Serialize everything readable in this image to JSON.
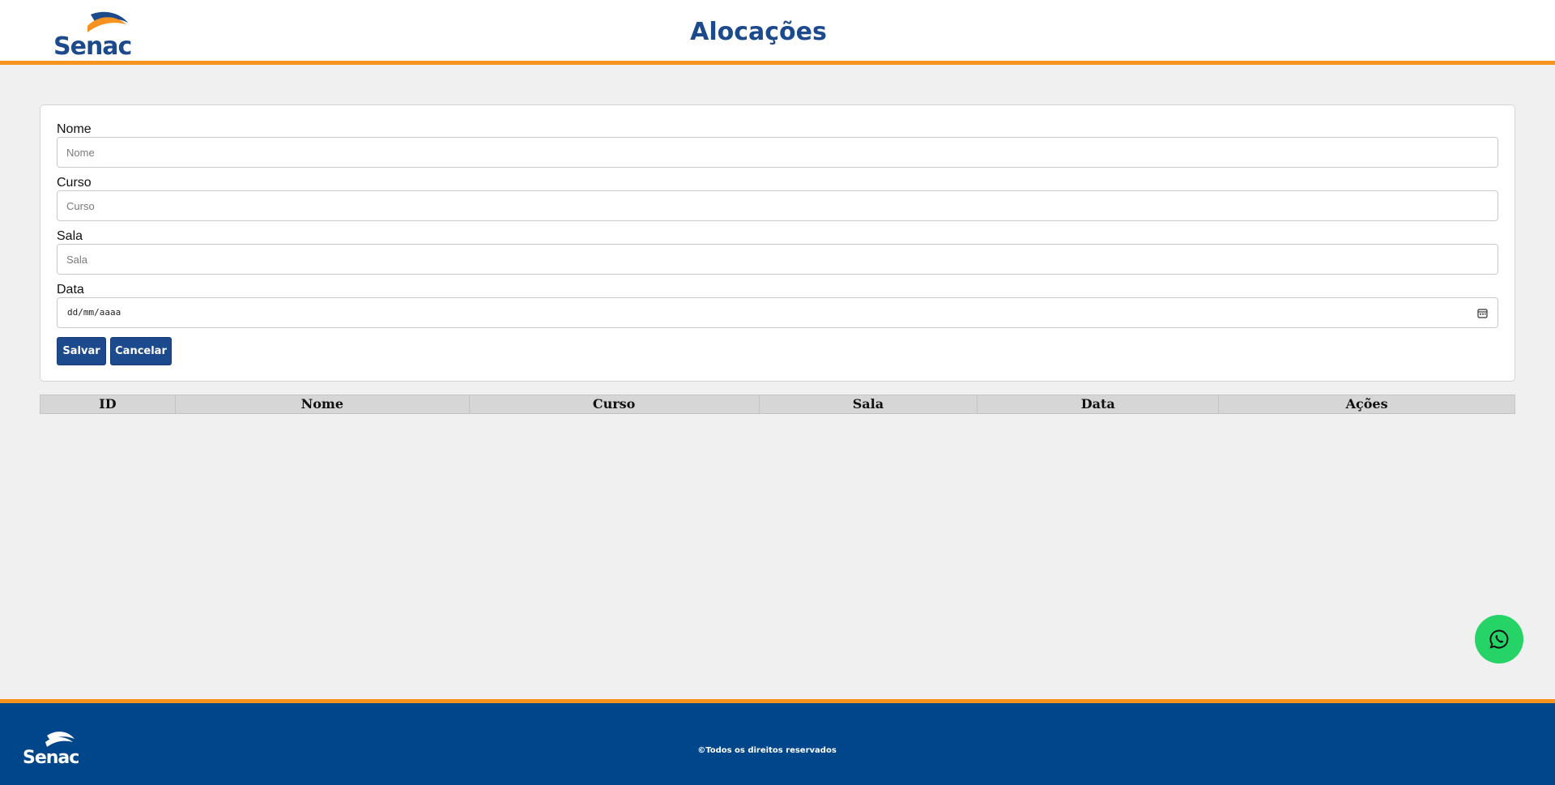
{
  "header": {
    "logo_text": "Senac",
    "title": "Alocações"
  },
  "form": {
    "fields": [
      {
        "label": "Nome",
        "placeholder": "Nome"
      },
      {
        "label": "Curso",
        "placeholder": "Curso"
      },
      {
        "label": "Sala",
        "placeholder": "Sala"
      }
    ],
    "date_field": {
      "label": "Data",
      "placeholder": "dd/mm/aaaa"
    },
    "save_label": "Salvar",
    "cancel_label": "Cancelar"
  },
  "table": {
    "columns": [
      "ID",
      "Nome",
      "Curso",
      "Sala",
      "Data",
      "Ações"
    ],
    "rows": []
  },
  "footer": {
    "logo_text": "Senac",
    "copyright": "©Todos os direitos reservados"
  },
  "colors": {
    "brand_blue": "#1c4a8c",
    "footer_blue": "#00468b",
    "accent_orange": "#f7921e",
    "whatsapp_green": "#25d366"
  },
  "icons": {
    "calendar": "calendar-icon",
    "whatsapp": "whatsapp-icon"
  }
}
